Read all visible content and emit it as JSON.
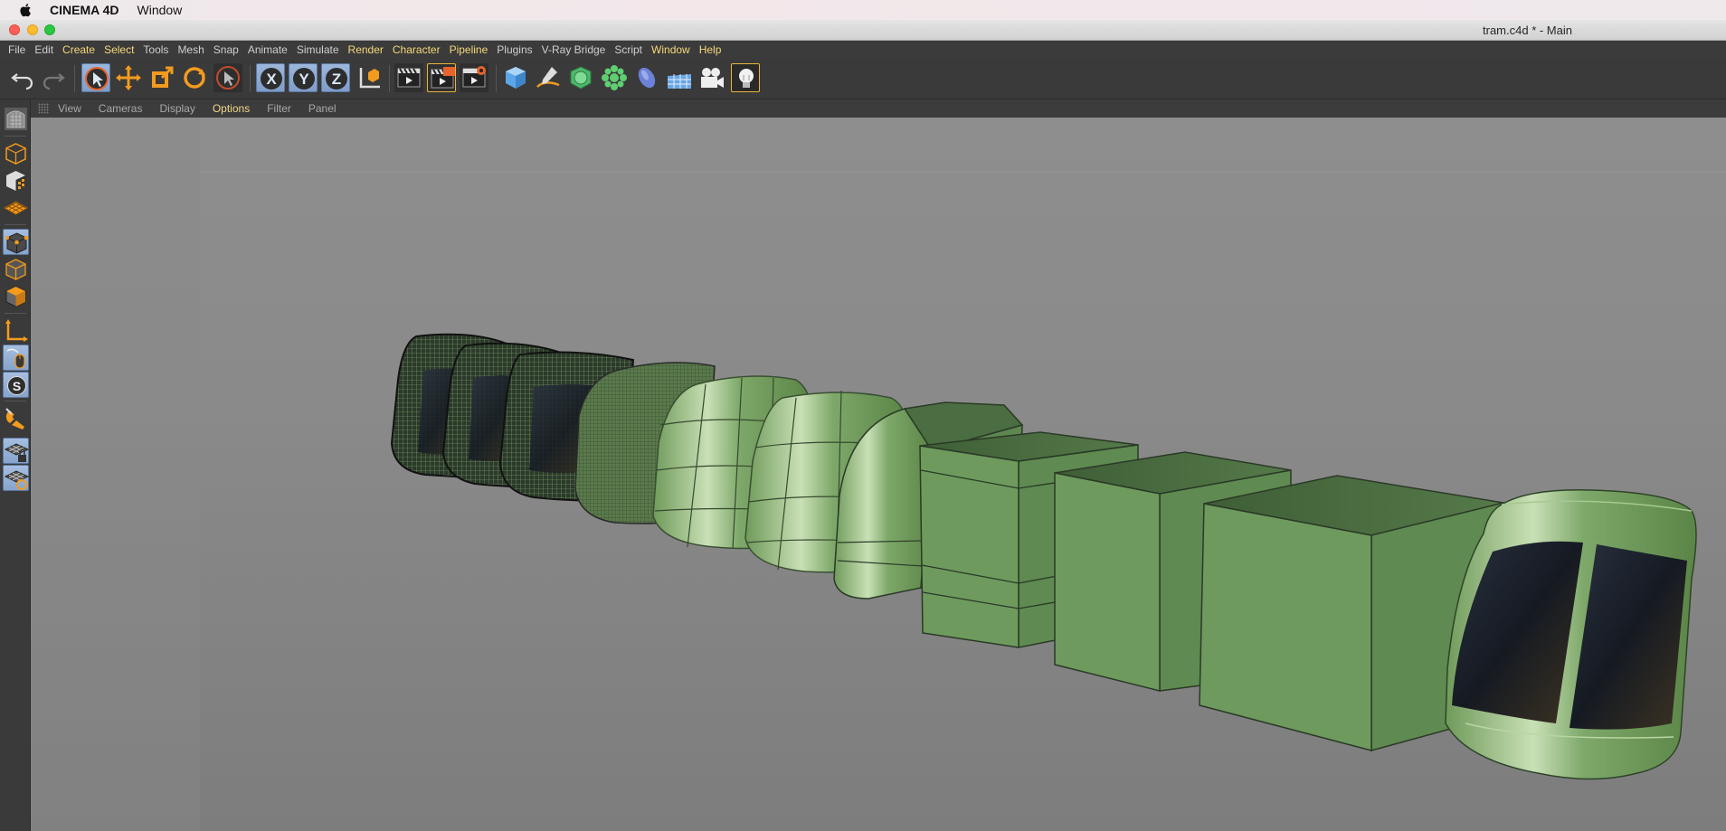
{
  "mac_menubar": {
    "app_name": "CINEMA 4D",
    "items": [
      "Window"
    ]
  },
  "window": {
    "title": "tram.c4d * - Main"
  },
  "menu": {
    "items": [
      {
        "label": "File"
      },
      {
        "label": "Edit"
      },
      {
        "label": "Create"
      },
      {
        "label": "Select"
      },
      {
        "label": "Tools"
      },
      {
        "label": "Mesh"
      },
      {
        "label": "Snap"
      },
      {
        "label": "Animate"
      },
      {
        "label": "Simulate"
      },
      {
        "label": "Render"
      },
      {
        "label": "Character"
      },
      {
        "label": "Pipeline"
      },
      {
        "label": "Plugins"
      },
      {
        "label": "V-Ray Bridge"
      },
      {
        "label": "Script"
      },
      {
        "label": "Window"
      },
      {
        "label": "Help"
      }
    ]
  },
  "toolbar": {
    "tools": [
      "undo-icon",
      "redo-icon",
      "live-selection-icon",
      "move-icon",
      "scale-icon",
      "rotate-icon",
      "recent-tool-icon",
      "x-axis-icon",
      "y-axis-icon",
      "z-axis-icon",
      "coordinate-system-icon",
      "render-view-icon",
      "render-picture-viewer-icon",
      "edit-render-settings-icon",
      "cube-icon",
      "pen-icon",
      "subdivision-surface-icon",
      "cloner-icon",
      "deformer-icon",
      "floor-icon",
      "camera-icon",
      "light-icon"
    ]
  },
  "viewport_menu": {
    "items": [
      {
        "label": "View"
      },
      {
        "label": "Cameras"
      },
      {
        "label": "Display"
      },
      {
        "label": "Options"
      },
      {
        "label": "Filter"
      },
      {
        "label": "Panel"
      }
    ]
  },
  "left_palette": {
    "tools": [
      "make-editable-icon",
      "model-mode-icon",
      "texture-mode-icon",
      "workplane-icon",
      "points-mode-icon",
      "edges-mode-icon",
      "polygons-mode-icon",
      "axis-mode-icon",
      "tweak-mode-icon",
      "solo-icon",
      "snap-icon",
      "workplane-lock-icon",
      "workplane-align-icon"
    ]
  },
  "colors": {
    "menu_highlight": "#f5d97a",
    "model_green": "#6f9a5a",
    "viewport_bg": "#8a8a8a"
  }
}
